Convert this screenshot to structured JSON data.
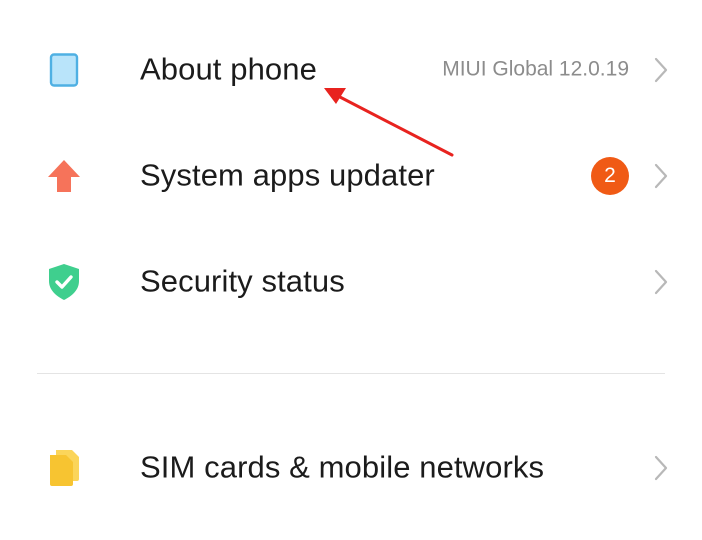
{
  "settings": {
    "items": [
      {
        "key": "about-phone",
        "label": "About phone",
        "value": "MIUI Global 12.0.19",
        "icon": "phone-icon",
        "icon_color": "#8fd3f4"
      },
      {
        "key": "system-apps-updater",
        "label": "System apps updater",
        "badge": "2",
        "icon": "arrow-up-icon",
        "icon_color": "#f6735a"
      },
      {
        "key": "security-status",
        "label": "Security status",
        "icon": "shield-check-icon",
        "icon_color": "#3fcf8e"
      },
      {
        "key": "sim-cards",
        "label": "SIM cards & mobile networks",
        "icon": "sim-card-icon",
        "icon_color": "#f7c431"
      }
    ]
  },
  "colors": {
    "badge": "#f05a15",
    "annotation_arrow": "#e8231f",
    "chevron": "#b8b8b8",
    "divider": "#e4e4e4"
  }
}
